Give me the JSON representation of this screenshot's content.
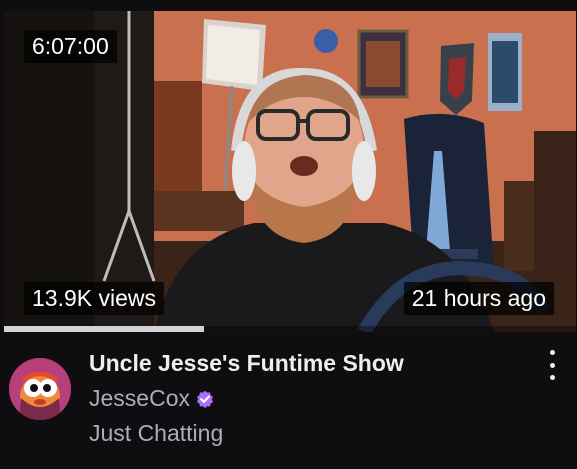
{
  "video": {
    "duration": "6:07:00",
    "views": "13.9K views",
    "age": "21 hours ago",
    "watch_progress": 0.35
  },
  "stream": {
    "title": "Uncle Jesse's Funtime Show",
    "channel": "JesseCox",
    "category": "Just Chatting",
    "verified": true
  },
  "icons": {
    "verified": "verified-badge-icon",
    "menu": "more-vertical-icon"
  },
  "colors": {
    "background": "#0e0e10",
    "verified_badge": "#a970ff",
    "secondary_text": "#adadb8"
  }
}
